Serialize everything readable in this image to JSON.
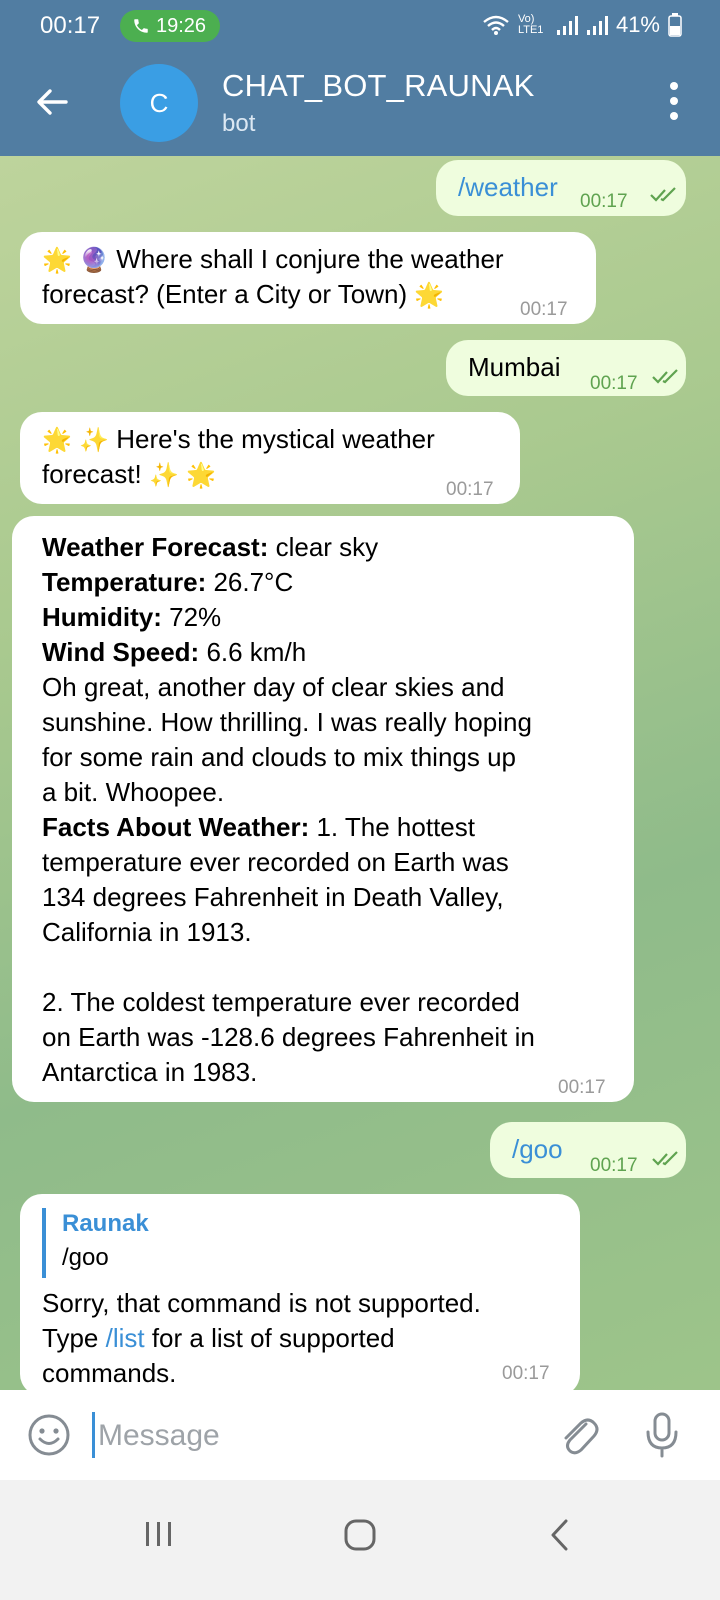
{
  "status": {
    "time": "00:17",
    "call_time": "19:26",
    "network_label": "Vo) LTE1",
    "battery": "41%"
  },
  "header": {
    "avatar_letter": "C",
    "title": "CHAT_BOT_RAUNAK",
    "subtitle": "bot"
  },
  "messages": [
    {
      "dir": "out",
      "text": "/weather",
      "time": "00:17"
    },
    {
      "dir": "in",
      "line1": "Where shall I conjure the weather",
      "line2": "forecast? (Enter a City or Town)",
      "time": "00:17"
    },
    {
      "dir": "out",
      "text": "Mumbai",
      "time": "00:17"
    },
    {
      "dir": "in",
      "line1": "Here's the mystical weather",
      "line2": "forecast!",
      "time": "00:17"
    },
    {
      "dir": "in",
      "forecast_label": "Weather Forecast:",
      "forecast_value": " clear sky",
      "temp_label": "Temperature:",
      "temp_value": " 26.7°C",
      "humidity_label": "Humidity:",
      "humidity_value": " 72%",
      "wind_label": "Wind Speed:",
      "wind_value": " 6.6 km/h",
      "comment_lines": [
        "Oh great, another day of clear skies and",
        "sunshine. How thrilling. I was really hoping",
        "for some rain and clouds to mix things up",
        "a bit. Whoopee."
      ],
      "facts_label": "Facts About Weather:",
      "facts_line1": " 1. The hottest",
      "facts_lines": [
        "temperature ever recorded on Earth was",
        "134 degrees Fahrenheit in Death Valley,",
        "California in 1913."
      ],
      "fact2_lines": [
        "2. The coldest temperature ever recorded",
        "on Earth was -128.6 degrees Fahrenheit in",
        "Antarctica in 1983."
      ],
      "time": "00:17"
    },
    {
      "dir": "out",
      "text": "/goo",
      "time": "00:17"
    },
    {
      "dir": "in",
      "reply_name": "Raunak",
      "reply_text": "/goo",
      "line1": "Sorry, that command is not supported.",
      "line2_pre": "Type ",
      "line2_link": "/list",
      "line2_post": " for a list of supported",
      "line3": "commands.",
      "time": "00:17"
    }
  ],
  "input": {
    "placeholder": "Message"
  },
  "colors": {
    "header": "#517da2",
    "outgoing_bubble": "#effdde",
    "incoming_bubble": "#ffffff",
    "link": "#3a8fd6",
    "call_pill": "#4caf50"
  },
  "icons": [
    "back-arrow-icon",
    "more-vert-icon",
    "check-double-icon",
    "emoji-icon",
    "attach-icon",
    "mic-icon",
    "phone-icon",
    "wifi-icon",
    "signal-icon",
    "battery-icon",
    "recents-icon",
    "home-icon",
    "nav-back-icon"
  ]
}
